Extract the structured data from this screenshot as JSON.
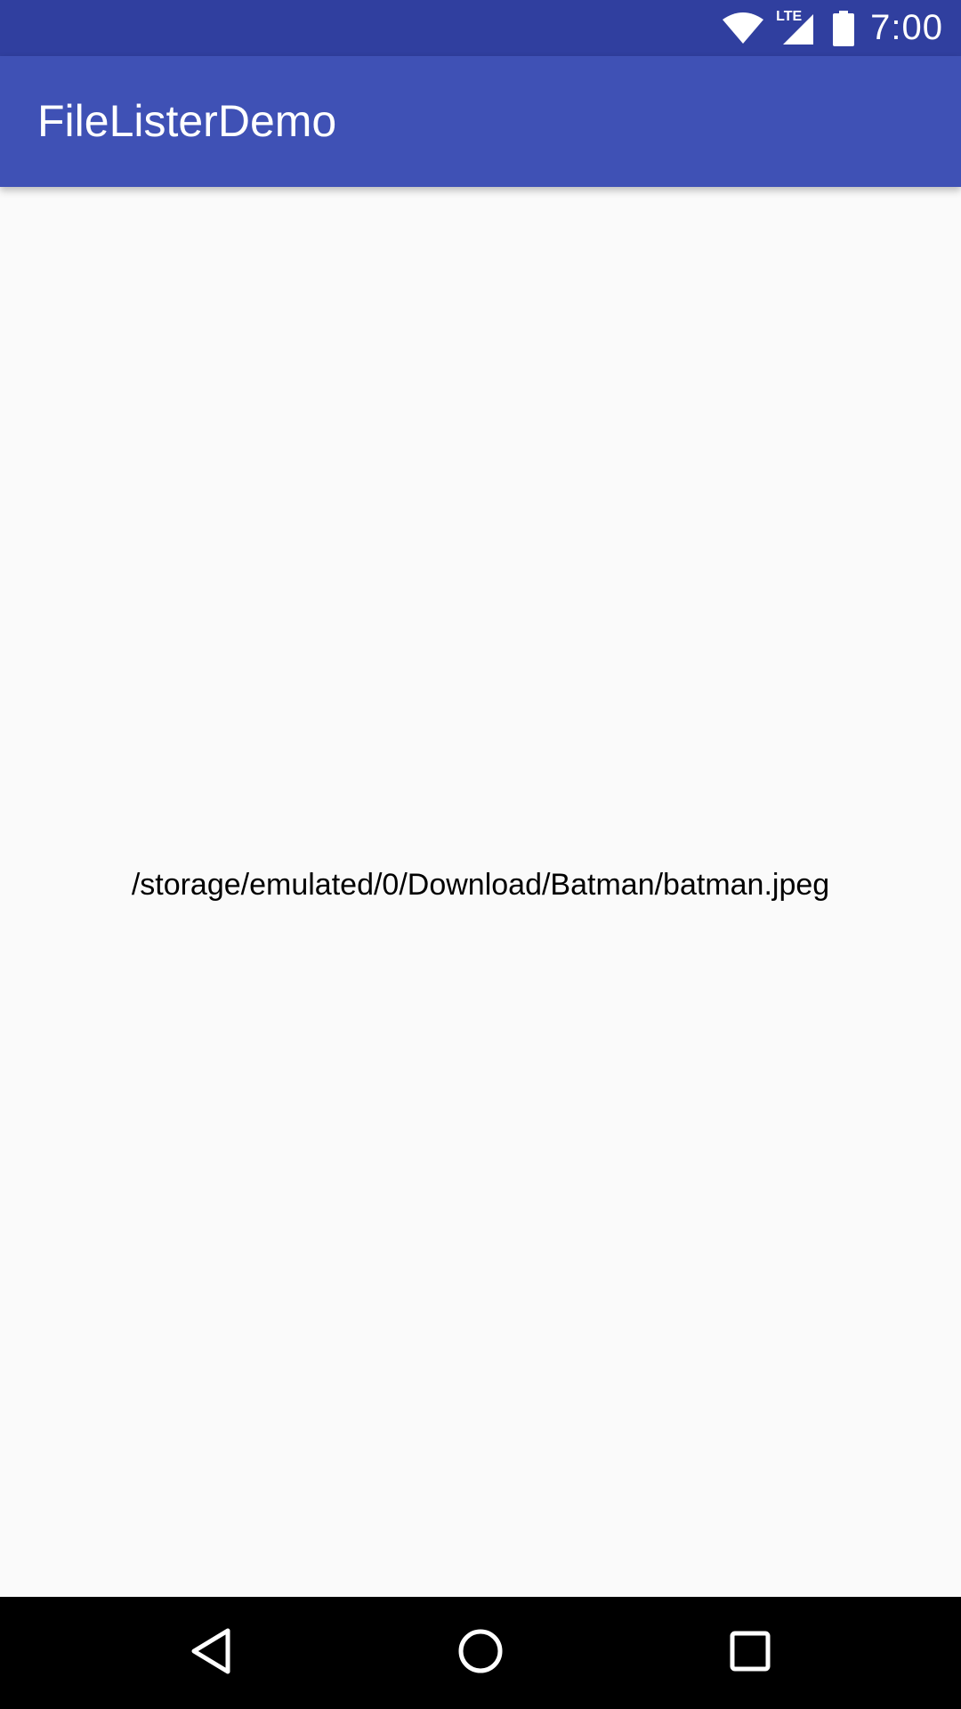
{
  "status_bar": {
    "time": "7:00",
    "network_label": "LTE",
    "icons": [
      "wifi-icon",
      "cellular-signal-icon",
      "battery-icon"
    ],
    "background_color": "#303f9f"
  },
  "app_bar": {
    "title": "FileListerDemo",
    "background_color": "#3f51b5"
  },
  "content": {
    "file_path": "/storage/emulated/0/Download/Batman/batman.jpeg"
  },
  "nav_bar": {
    "buttons": [
      "back-icon",
      "home-icon",
      "recents-icon"
    ]
  }
}
